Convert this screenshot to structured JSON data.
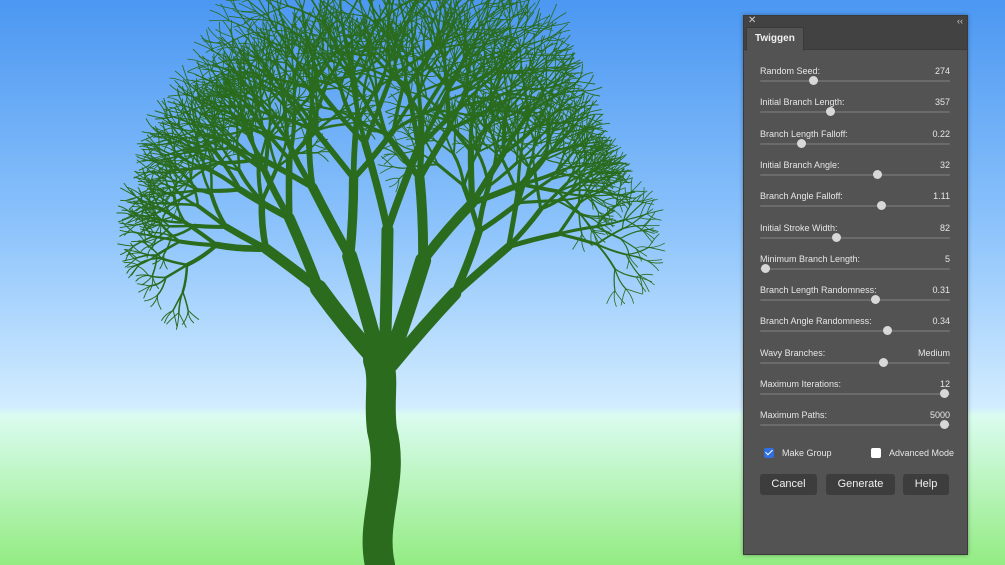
{
  "colors": {
    "sky_top": "#4b97f2",
    "sky_mid": "#cde9ff",
    "horizon": "#d9fbee",
    "grass": "#98ed86",
    "tree": "#2a6b1e",
    "panel_bg": "#535353",
    "accent": "#2f6fe0"
  },
  "panel": {
    "close_icon": "✕",
    "collapse_icon": "‹‹",
    "tab_label": "Twiggen",
    "sliders": [
      {
        "label": "Random Seed:",
        "value": "274",
        "fraction": 0.28
      },
      {
        "label": "Initial Branch Length:",
        "value": "357",
        "fraction": 0.37
      },
      {
        "label": "Branch Length Falloff:",
        "value": "0.22",
        "fraction": 0.22
      },
      {
        "label": "Initial Branch Angle:",
        "value": "32",
        "fraction": 0.62
      },
      {
        "label": "Branch Angle Falloff:",
        "value": "1.11",
        "fraction": 0.64
      },
      {
        "label": "Initial Stroke Width:",
        "value": "82",
        "fraction": 0.4
      },
      {
        "label": "Minimum Branch Length:",
        "value": "5",
        "fraction": 0.03
      },
      {
        "label": "Branch Length Randomness:",
        "value": "0.31",
        "fraction": 0.61
      },
      {
        "label": "Branch Angle Randomness:",
        "value": "0.34",
        "fraction": 0.67
      },
      {
        "label": "Wavy Branches:",
        "value": "Medium",
        "fraction": 0.65
      },
      {
        "label": "Maximum Iterations:",
        "value": "12",
        "fraction": 0.97
      },
      {
        "label": "Maximum Paths:",
        "value": "5000",
        "fraction": 0.97
      }
    ],
    "make_group": {
      "label": "Make Group",
      "checked": true
    },
    "advanced_mode": {
      "label": "Advanced Mode",
      "checked": false
    },
    "buttons": {
      "cancel": "Cancel",
      "generate": "Generate",
      "help": "Help"
    }
  }
}
